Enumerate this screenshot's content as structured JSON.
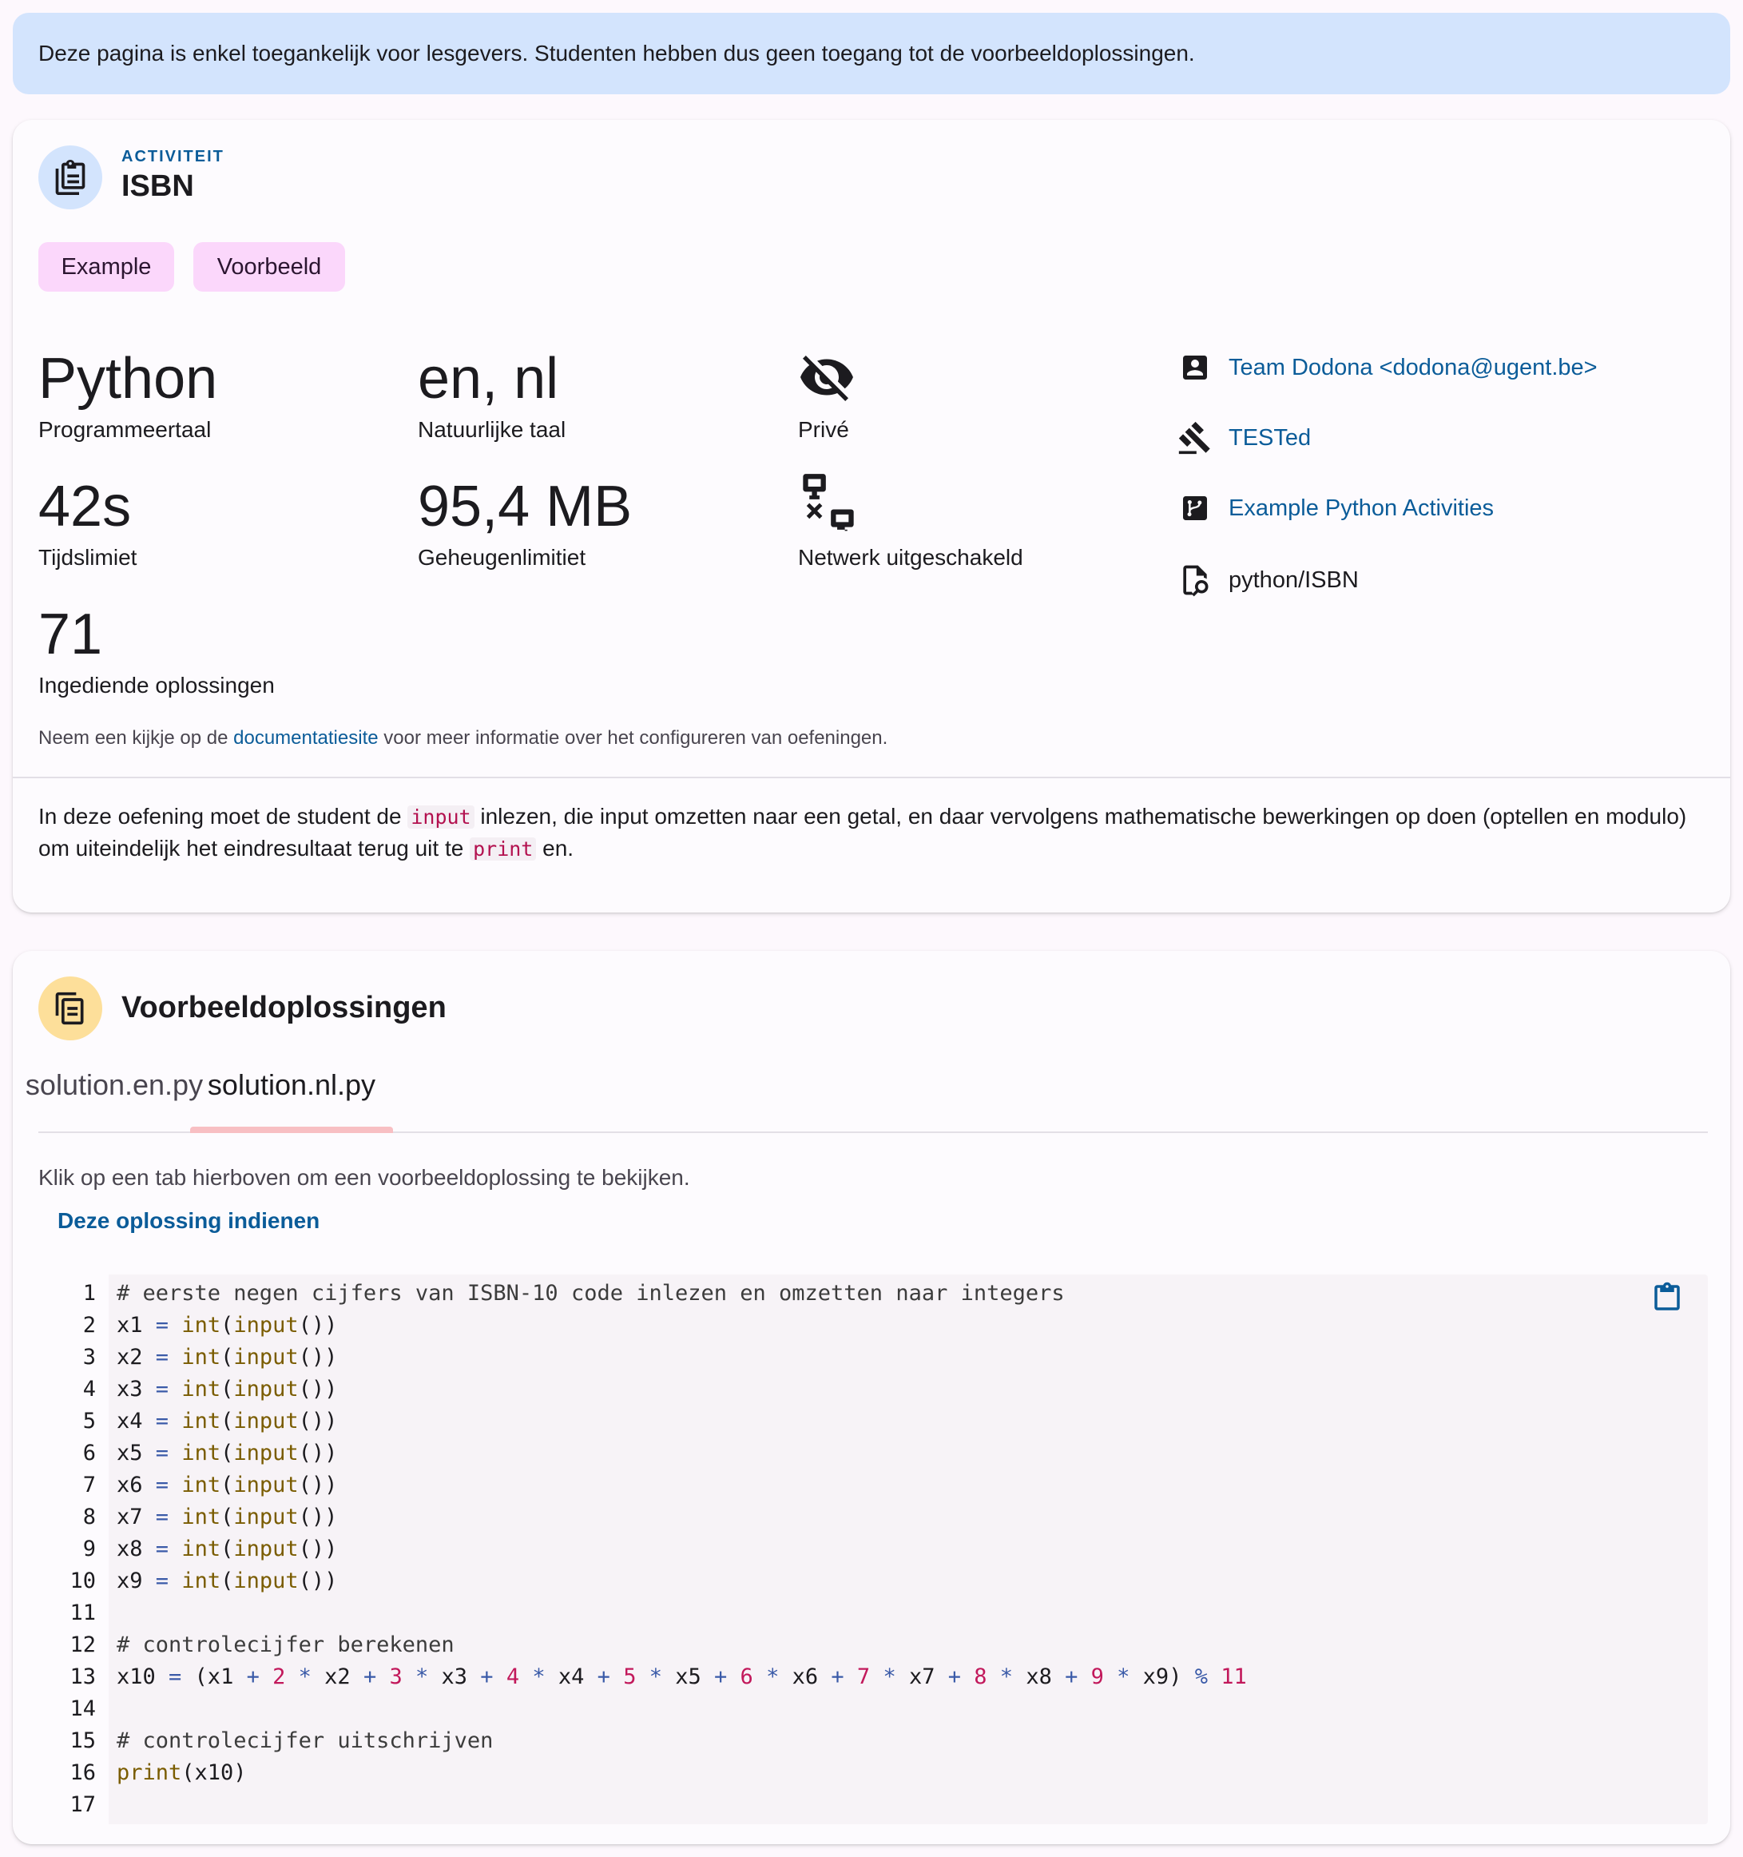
{
  "alert": {
    "text": "Deze pagina is enkel toegankelijk voor lesgevers. Studenten hebben dus geen toegang tot de voorbeeldoplossingen."
  },
  "activity": {
    "overline": "ACTIVITEIT",
    "title": "ISBN",
    "labels": [
      "Example",
      "Voorbeeld"
    ],
    "stats": [
      {
        "value": "Python",
        "label": "Programmeertaal"
      },
      {
        "value": "en, nl",
        "label": "Natuurlijke taal"
      },
      {
        "value": "",
        "label": "Privé",
        "icon": "eye-off-icon"
      },
      {
        "value": "42s",
        "label": "Tijdslimiet"
      },
      {
        "value": "95,4 MB",
        "label": "Geheugenlimitiet"
      },
      {
        "value": "",
        "label": "Netwerk uitgeschakeld",
        "icon": "network-off-icon"
      },
      {
        "value": "71",
        "label": "Ingediende oplossingen"
      }
    ],
    "info": [
      {
        "icon": "account-box-icon",
        "text": "Team Dodona <dodona@ugent.be>",
        "link": true
      },
      {
        "icon": "gavel-icon",
        "text": "TESTed",
        "link": true
      },
      {
        "icon": "source-branch-icon",
        "text": "Example Python Activities",
        "link": true
      },
      {
        "icon": "file-search-icon",
        "text": "python/ISBN",
        "link": false
      }
    ],
    "doc_note": {
      "before": "Neem een kijkje op de ",
      "link": "documentatiesite",
      "after": " voor meer informatie over het configureren van oefeningen."
    },
    "description": {
      "part1": "In deze oefening moet de student de ",
      "code1": "input",
      "part2": " inlezen, die input omzetten naar een getal, en daar vervolgens mathematische bewerkingen op doen (optellen en modulo) om uiteindelijk het eindresultaat terug uit te ",
      "code2": "print",
      "part3": " en."
    }
  },
  "solutions": {
    "title": "Voorbeeldoplossingen",
    "tabs": [
      "solution.en.py",
      "solution.nl.py"
    ],
    "active_tab": 1,
    "hint": "Klik op een tab hierboven om een voorbeeldoplossing te bekijken.",
    "submit_label": "Deze oplossing indienen",
    "code_lines": [
      "# eerste negen cijfers van ISBN-10 code inlezen en omzetten naar integers",
      "x1 = int(input())",
      "x2 = int(input())",
      "x3 = int(input())",
      "x4 = int(input())",
      "x5 = int(input())",
      "x6 = int(input())",
      "x7 = int(input())",
      "x8 = int(input())",
      "x9 = int(input())",
      "",
      "# controlecijfer berekenen",
      "x10 = (x1 + 2 * x2 + 3 * x3 + 4 * x4 + 5 * x5 + 6 * x6 + 7 * x7 + 8 * x8 + 9 * x9) % 11",
      "",
      "# controlecijfer uitschrijven",
      "print(x10)",
      ""
    ]
  }
}
